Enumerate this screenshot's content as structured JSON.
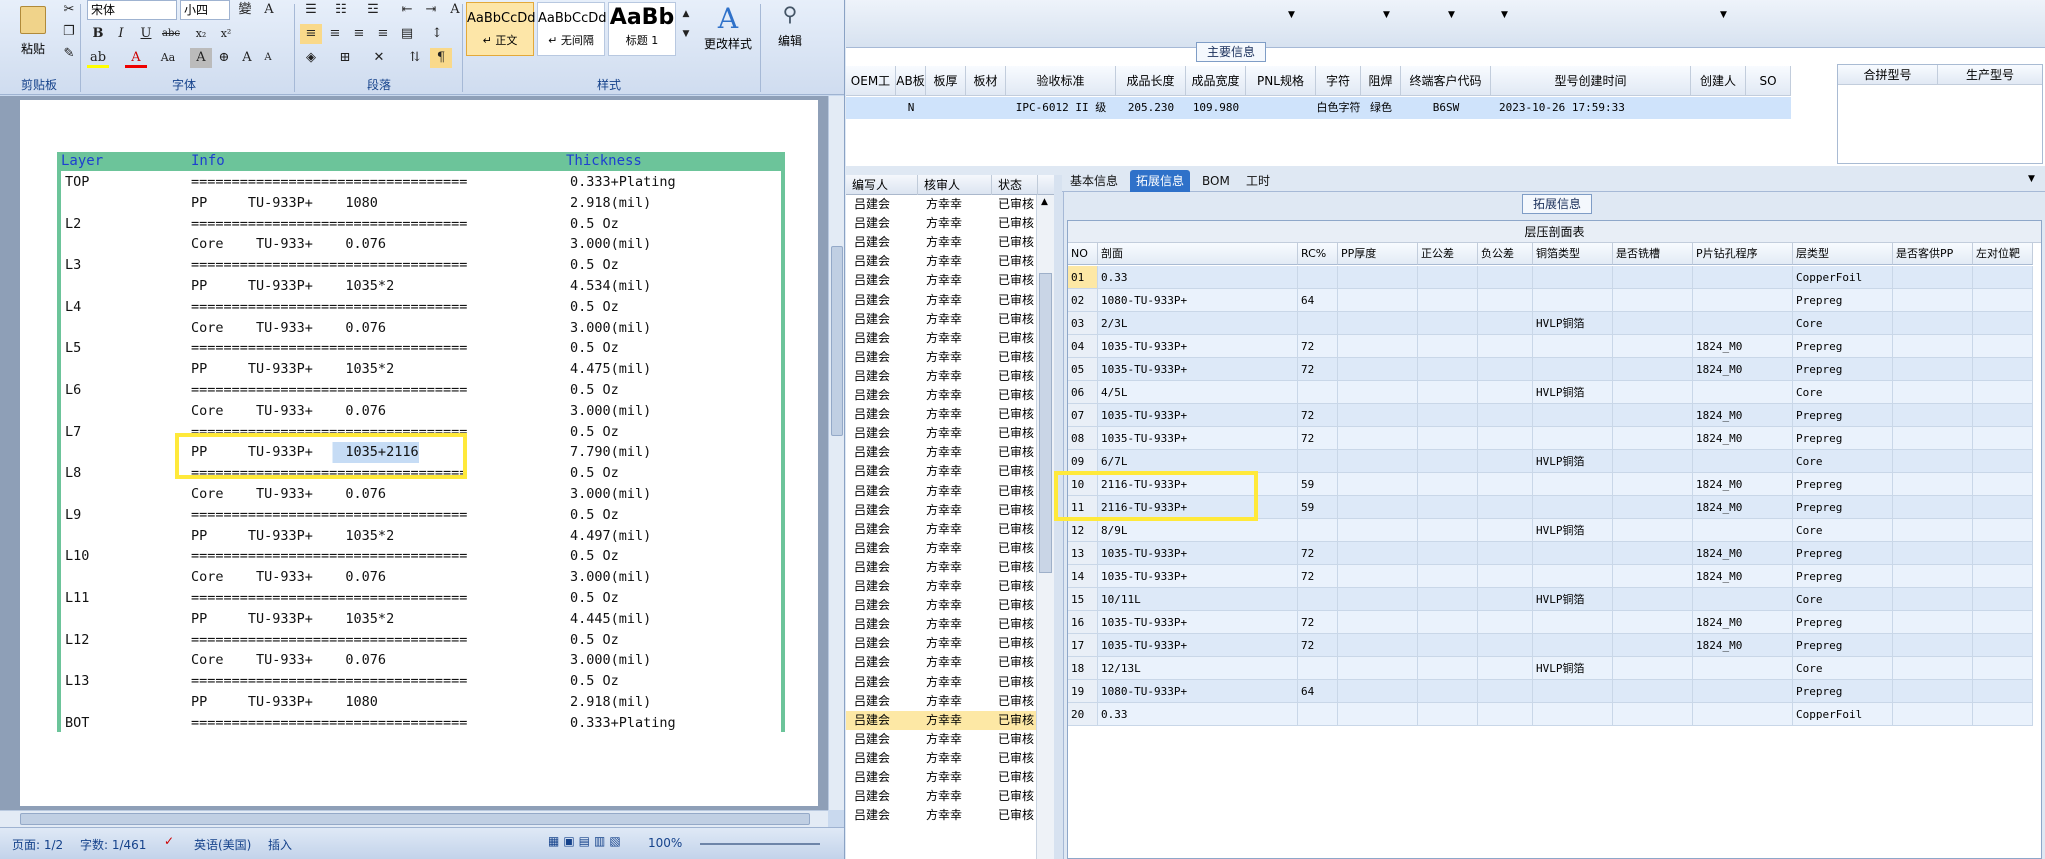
{
  "word": {
    "ribbon": {
      "clipboard": {
        "paste": "粘贴",
        "group": "剪贴板"
      },
      "font": {
        "name": "宋体",
        "size": "小四",
        "group": "字体",
        "bold": "B",
        "italic": "I",
        "underline": "U",
        "strike": "abc",
        "sub": "x₂",
        "sup": "x²",
        "font_color": "A",
        "aa": "Aa",
        "grow": "A",
        "shrink": "A",
        "clear": "A"
      },
      "paragraph": {
        "group": "段落"
      },
      "styles": {
        "group": "样式",
        "items": [
          {
            "sample": "AaBbCcDd",
            "name": "↵ 正文"
          },
          {
            "sample": "AaBbCcDd",
            "name": "↵ 无间隔"
          },
          {
            "sample": "AaBb",
            "name": "标题 1"
          }
        ],
        "change": "更改样式"
      },
      "editing": {
        "label": "编辑"
      }
    },
    "doc": {
      "headers": {
        "layer": "Layer",
        "info": "Info",
        "thickness": "Thickness"
      },
      "rows": [
        {
          "layer": "TOP",
          "info": "==================================",
          "thick": "0.333+Plating"
        },
        {
          "layer": "",
          "info": "PP     TU-933P+    1080",
          "thick": "2.918(mil)"
        },
        {
          "layer": "L2",
          "info": "==================================",
          "thick": "0.5 Oz"
        },
        {
          "layer": "",
          "info": "Core    TU-933+    0.076",
          "thick": "3.000(mil)"
        },
        {
          "layer": "L3",
          "info": "==================================",
          "thick": "0.5 Oz"
        },
        {
          "layer": "",
          "info": "PP     TU-933P+    1035*2",
          "thick": "4.534(mil)"
        },
        {
          "layer": "L4",
          "info": "==================================",
          "thick": "0.5 Oz"
        },
        {
          "layer": "",
          "info": "Core    TU-933+    0.076",
          "thick": "3.000(mil)"
        },
        {
          "layer": "L5",
          "info": "==================================",
          "thick": "0.5 Oz"
        },
        {
          "layer": "",
          "info": "PP     TU-933P+    1035*2",
          "thick": "4.475(mil)"
        },
        {
          "layer": "L6",
          "info": "==================================",
          "thick": "0.5 Oz"
        },
        {
          "layer": "",
          "info": "Core    TU-933+    0.076",
          "thick": "3.000(mil)"
        },
        {
          "layer": "L7",
          "info": "==================================",
          "thick": "0.5 Oz"
        },
        {
          "layer": "",
          "info": "PP     TU-933P+    1035+2116",
          "thick": "7.790(mil)"
        },
        {
          "layer": "L8",
          "info": "==================================",
          "thick": "0.5 Oz"
        },
        {
          "layer": "",
          "info": "Core    TU-933+    0.076",
          "thick": "3.000(mil)"
        },
        {
          "layer": "L9",
          "info": "==================================",
          "thick": "0.5 Oz"
        },
        {
          "layer": "",
          "info": "PP     TU-933P+    1035*2",
          "thick": "4.497(mil)"
        },
        {
          "layer": "L10",
          "info": "==================================",
          "thick": "0.5 Oz"
        },
        {
          "layer": "",
          "info": "Core    TU-933+    0.076",
          "thick": "3.000(mil)"
        },
        {
          "layer": "L11",
          "info": "==================================",
          "thick": "0.5 Oz"
        },
        {
          "layer": "",
          "info": "PP     TU-933P+    1035*2",
          "thick": "4.445(mil)"
        },
        {
          "layer": "L12",
          "info": "==================================",
          "thick": "0.5 Oz"
        },
        {
          "layer": "",
          "info": "Core    TU-933+    0.076",
          "thick": "3.000(mil)"
        },
        {
          "layer": "L13",
          "info": "==================================",
          "thick": "0.5 Oz"
        },
        {
          "layer": "",
          "info": "PP     TU-933P+    1080",
          "thick": "2.918(mil)"
        },
        {
          "layer": "BOT",
          "info": "==================================",
          "thick": "0.333+Plating"
        }
      ]
    },
    "status": {
      "page": "页面: 1/2",
      "words": "字数: 1/461",
      "lang": "英语(美国)",
      "mode": "插入",
      "zoom": "100%"
    }
  },
  "middle": {
    "headers": [
      "编写人",
      "核审人",
      "状态"
    ],
    "rows_writer": "吕建会",
    "rows_reviewer": "方幸幸",
    "rows_status": "已审核",
    "row_count": 33,
    "selected_index": 27
  },
  "info_section": {
    "title": "主要信息",
    "headers": [
      "OEM工厂",
      "AB板",
      "板厚",
      "板材",
      "验收标准",
      "成品长度",
      "成品宽度",
      "PNL规格",
      "字符",
      "阻焊",
      "终端客户代码",
      "型号创建时间",
      "创建人",
      "SO"
    ],
    "values": [
      "",
      "N",
      "",
      "",
      "IPC-6012 II 级",
      "205.230",
      "109.980",
      "",
      "白色字符",
      "绿色",
      "B6SW",
      "2023-10-26 17:59:33",
      "",
      ""
    ],
    "right_headers": [
      "合拼型号",
      "生产型号"
    ]
  },
  "tabs": [
    "基本信息",
    "拓展信息",
    "BOM",
    "工时"
  ],
  "selected_tab": 1,
  "ext_section": {
    "title": "拓展信息",
    "table_title": "层压剖面表"
  },
  "grid": {
    "headers": [
      "NO",
      "剖面",
      "RC%",
      "PP厚度",
      "正公差",
      "负公差",
      "铜箔类型",
      "是否铣槽",
      "P片钻孔程序",
      "层类型",
      "是否客供PP",
      "左对位靶"
    ],
    "rows": [
      [
        "01",
        "0.33",
        "",
        "",
        "",
        "",
        "",
        "",
        "",
        "CopperFoil"
      ],
      [
        "02",
        "1080-TU-933P+",
        "64",
        "",
        "",
        "",
        "",
        "",
        "",
        "Prepreg"
      ],
      [
        "03",
        "2/3L",
        "",
        "",
        "",
        "",
        "HVLP铜箔",
        "",
        "",
        "Core"
      ],
      [
        "04",
        "1035-TU-933P+",
        "72",
        "",
        "",
        "",
        "",
        "",
        "1824_M0",
        "Prepreg"
      ],
      [
        "05",
        "1035-TU-933P+",
        "72",
        "",
        "",
        "",
        "",
        "",
        "1824_M0",
        "Prepreg"
      ],
      [
        "06",
        "4/5L",
        "",
        "",
        "",
        "",
        "HVLP铜箔",
        "",
        "",
        "Core"
      ],
      [
        "07",
        "1035-TU-933P+",
        "72",
        "",
        "",
        "",
        "",
        "",
        "1824_M0",
        "Prepreg"
      ],
      [
        "08",
        "1035-TU-933P+",
        "72",
        "",
        "",
        "",
        "",
        "",
        "1824_M0",
        "Prepreg"
      ],
      [
        "09",
        "6/7L",
        "",
        "",
        "",
        "",
        "HVLP铜箔",
        "",
        "",
        "Core"
      ],
      [
        "10",
        "2116-TU-933P+",
        "59",
        "",
        "",
        "",
        "",
        "",
        "1824_M0",
        "Prepreg"
      ],
      [
        "11",
        "2116-TU-933P+",
        "59",
        "",
        "",
        "",
        "",
        "",
        "1824_M0",
        "Prepreg"
      ],
      [
        "12",
        "8/9L",
        "",
        "",
        "",
        "",
        "HVLP铜箔",
        "",
        "",
        "Core"
      ],
      [
        "13",
        "1035-TU-933P+",
        "72",
        "",
        "",
        "",
        "",
        "",
        "1824_M0",
        "Prepreg"
      ],
      [
        "14",
        "1035-TU-933P+",
        "72",
        "",
        "",
        "",
        "",
        "",
        "1824_M0",
        "Prepreg"
      ],
      [
        "15",
        "10/11L",
        "",
        "",
        "",
        "",
        "HVLP铜箔",
        "",
        "",
        "Core"
      ],
      [
        "16",
        "1035-TU-933P+",
        "72",
        "",
        "",
        "",
        "",
        "",
        "1824_M0",
        "Prepreg"
      ],
      [
        "17",
        "1035-TU-933P+",
        "72",
        "",
        "",
        "",
        "",
        "",
        "1824_M0",
        "Prepreg"
      ],
      [
        "18",
        "12/13L",
        "",
        "",
        "",
        "",
        "HVLP铜箔",
        "",
        "",
        "Core"
      ],
      [
        "19",
        "1080-TU-933P+",
        "64",
        "",
        "",
        "",
        "",
        "",
        "",
        "Prepreg"
      ],
      [
        "20",
        "0.33",
        "",
        "",
        "",
        "",
        "",
        "",
        "",
        "CopperFoil"
      ]
    ]
  },
  "colors": {
    "accent": "#2f71c9",
    "highlight": "#ffe93a",
    "stack_band": "#6cc49a",
    "selection": "#cfe3fb"
  }
}
